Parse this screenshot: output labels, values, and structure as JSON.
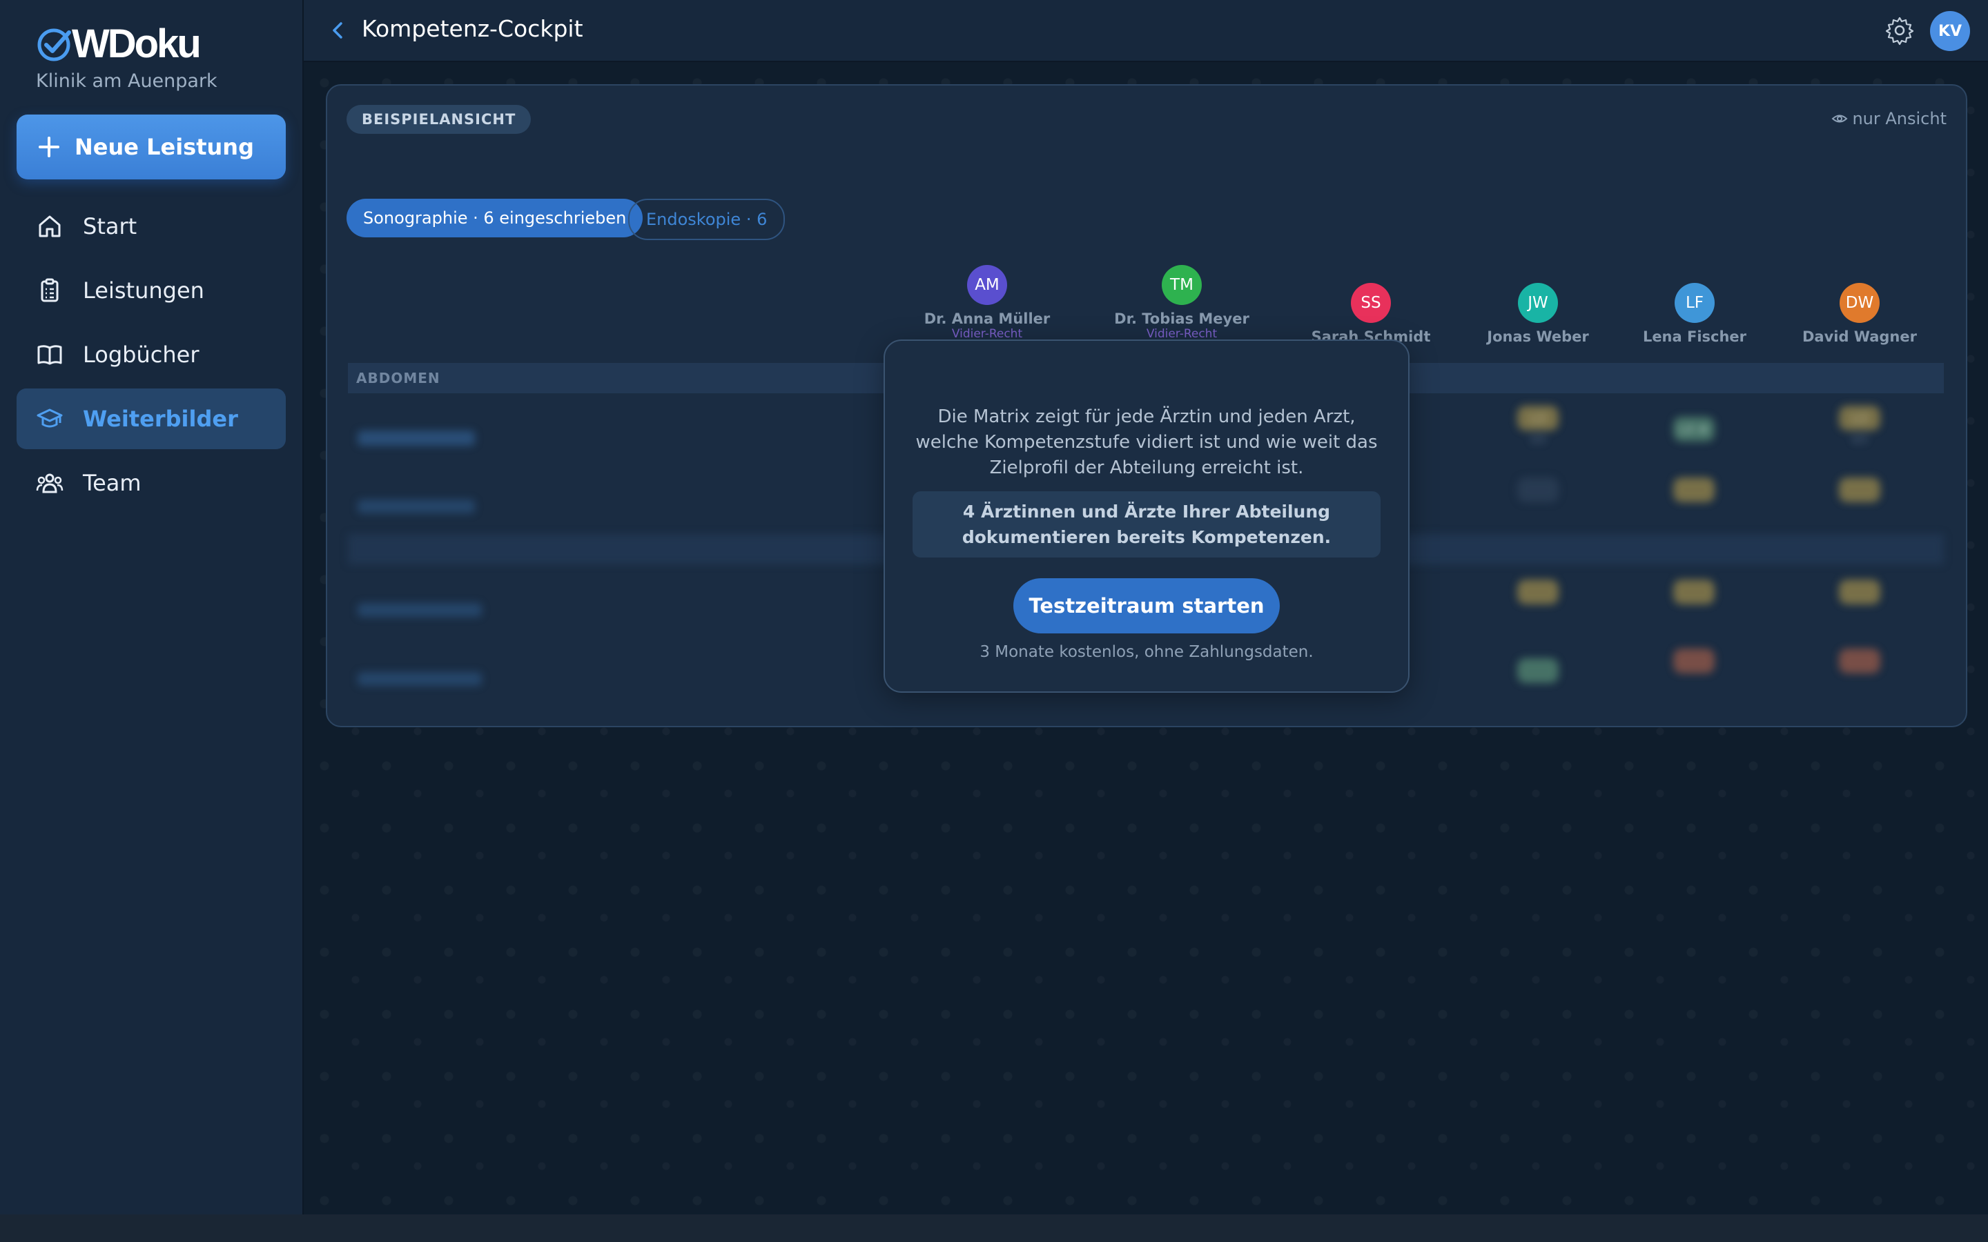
{
  "app": {
    "logo_text": "WDoku",
    "clinic": "Klinik am Auenpark"
  },
  "sidebar": {
    "new_button": "Neue Leistung",
    "items": [
      {
        "label": "Start",
        "icon": "home-icon",
        "active": false
      },
      {
        "label": "Leistungen",
        "icon": "clipboard-icon",
        "active": false
      },
      {
        "label": "Logbücher",
        "icon": "book-icon",
        "active": false
      },
      {
        "label": "Weiterbilder",
        "icon": "graduation-cap-icon",
        "active": true
      },
      {
        "label": "Team",
        "icon": "team-icon",
        "active": false
      }
    ]
  },
  "header": {
    "title": "Kompetenz-Cockpit",
    "user_initials": "KV"
  },
  "card": {
    "badge": "BEISPIELANSICHT",
    "view_only": "nur Ansicht",
    "tabs": [
      "Sonographie · 6 eingeschrieben",
      "Endoskopie · 6"
    ],
    "columns": [
      {
        "initials": "AM",
        "name": "Dr. Anna Müller",
        "note": "Vidier-Recht",
        "color": "#5a4fcf"
      },
      {
        "initials": "TM",
        "name": "Dr. Tobias Meyer",
        "note": "Vidier-Recht",
        "color": "#2eb24f"
      },
      {
        "initials": "SS",
        "name": "Sarah Schmidt",
        "note": "",
        "color": "#e8315b"
      },
      {
        "initials": "JW",
        "name": "Jonas Weber",
        "note": "",
        "color": "#19b4a5"
      },
      {
        "initials": "LF",
        "name": "Lena Fischer",
        "note": "",
        "color": "#3f96d8"
      },
      {
        "initials": "DW",
        "name": "David Wagner",
        "note": "",
        "color": "#e07a2c"
      }
    ],
    "section": "ABDOMEN",
    "chips": {
      "l3": "L3",
      "l4": "L4 ★",
      "sub1": "3/5",
      "sub2": "4/5"
    }
  },
  "modal": {
    "text": "Die Matrix zeigt für jede Ärztin und jeden Arzt, welche Kompetenzstufe vidiert ist und wie weit das Zielprofil der Abteilung erreicht ist.",
    "highlight": "4 Ärztinnen und Ärzte Ihrer Abteilung dokumentieren bereits Kompetenzen.",
    "cta": "Testzeitraum starten",
    "note": "3 Monate kostenlos, ohne Zahlungsdaten."
  },
  "colors": {
    "accent": "#2f71c7",
    "sidebar_bg": "#17283d",
    "active_text": "#4f9ff1"
  }
}
